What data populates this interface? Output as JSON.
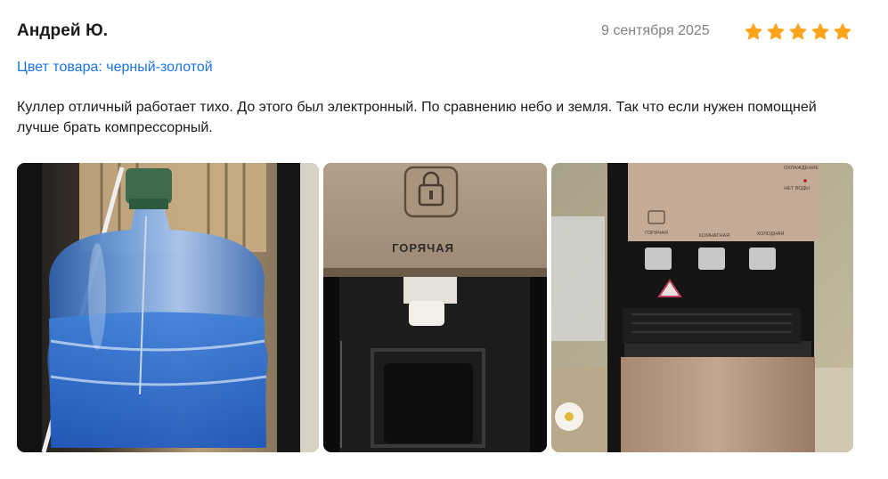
{
  "review": {
    "author": "Андрей Ю.",
    "date": "9 сентября 2025",
    "rating": 5,
    "rating_max": 5,
    "star_color": "#ffa31a",
    "variant": "Цвет товара: черный-золотой",
    "text": "Куллер отличный работает тихо. До этого был электронный. По сравнению небо и земля. Так что если нужен помощней лучше брать компрессорный.",
    "photos": {
      "photo2_label": "ГОРЯЧАЯ",
      "photo3_status1": "ОХЛАЖДЕНИЕ",
      "photo3_status2": "НЕТ ВОДЫ",
      "photo3_tap1": "ГОРЯЧАЯ",
      "photo3_tap2": "КОМНАТНАЯ",
      "photo3_tap3": "ХОЛОДНАЯ"
    }
  }
}
